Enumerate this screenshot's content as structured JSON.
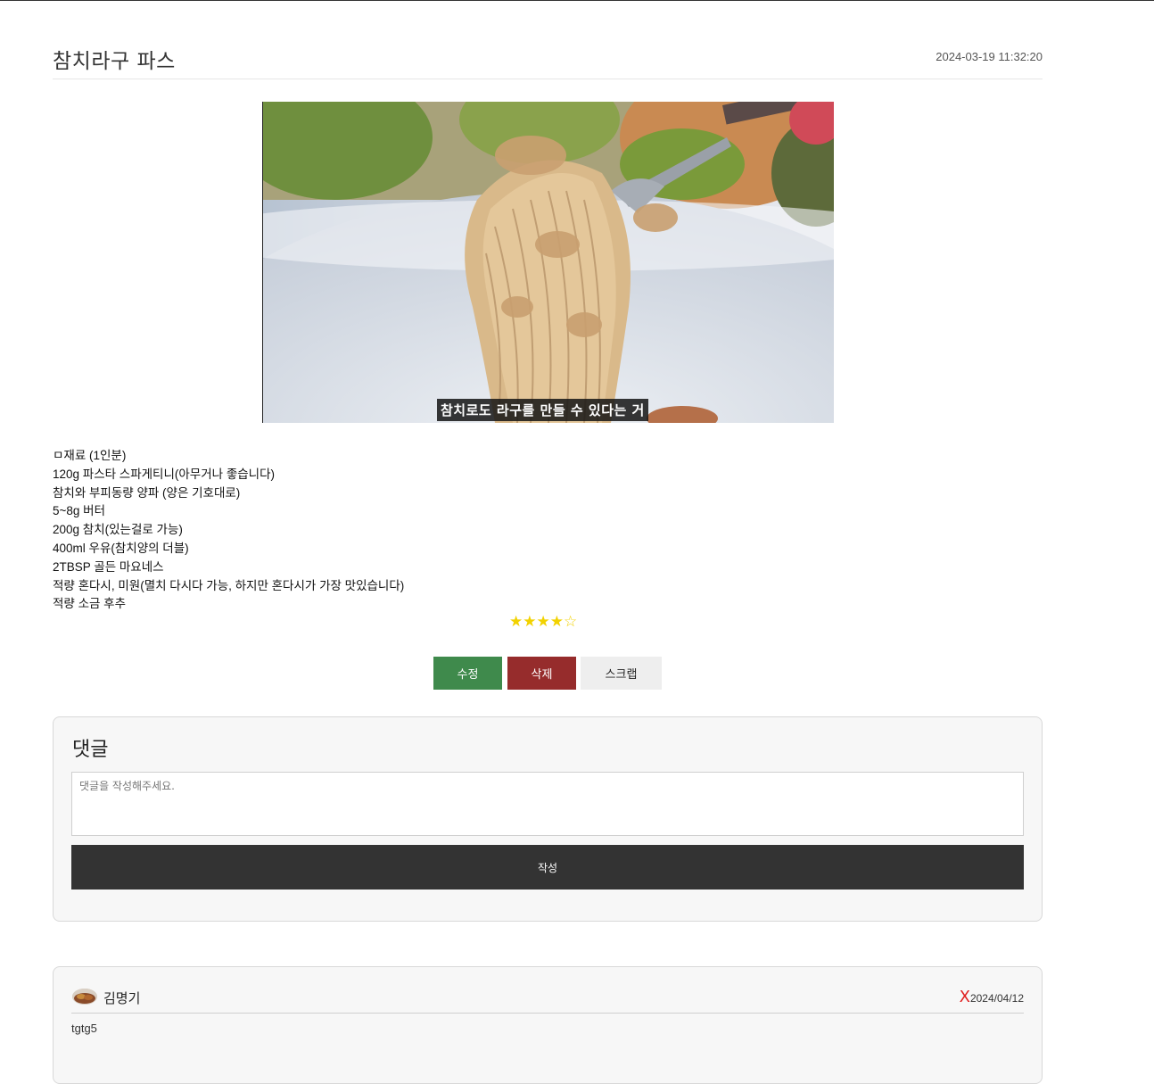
{
  "post": {
    "title": "참치라구 파스",
    "date": "2024-03-19 11:32:20"
  },
  "video": {
    "subtitle": "참치로도 라구를 만들 수 있다는 거"
  },
  "recipe": {
    "lines": [
      "ㅁ재료 (1인분)",
      "120g 파스타 스파게티니(아무거나 좋습니다)",
      "참치와 부피동량 양파 (양은 기호대로)",
      "5~8g 버터",
      "200g 참치(있는걸로 가능)",
      "400ml 우유(참치양의 더블)",
      "2TBSP 골든 마요네스",
      "적량 혼다시, 미원(멸치 다시다 가능, 하지만 혼다시가 가장 맛있습니다)",
      "적량 소금 후추"
    ]
  },
  "rating": {
    "value": 4,
    "max": 5,
    "display": "★★★★☆",
    "color": "#f2d200"
  },
  "actions": {
    "edit_label": "수정",
    "delete_label": "삭제",
    "scrap_label": "스크랩"
  },
  "comment_form": {
    "heading": "댓글",
    "placeholder": "댓글을 작성해주세요.",
    "submit_label": "작성"
  },
  "comments": [
    {
      "author": "김명기",
      "delete_icon": "X",
      "date": "2024/04/12",
      "body": "tgtg5"
    }
  ],
  "colors": {
    "edit": "#3f8a4c",
    "delete": "#962c2c",
    "scrap": "#eeeeee",
    "submit": "#333333",
    "delete_icon": "#e02020"
  }
}
